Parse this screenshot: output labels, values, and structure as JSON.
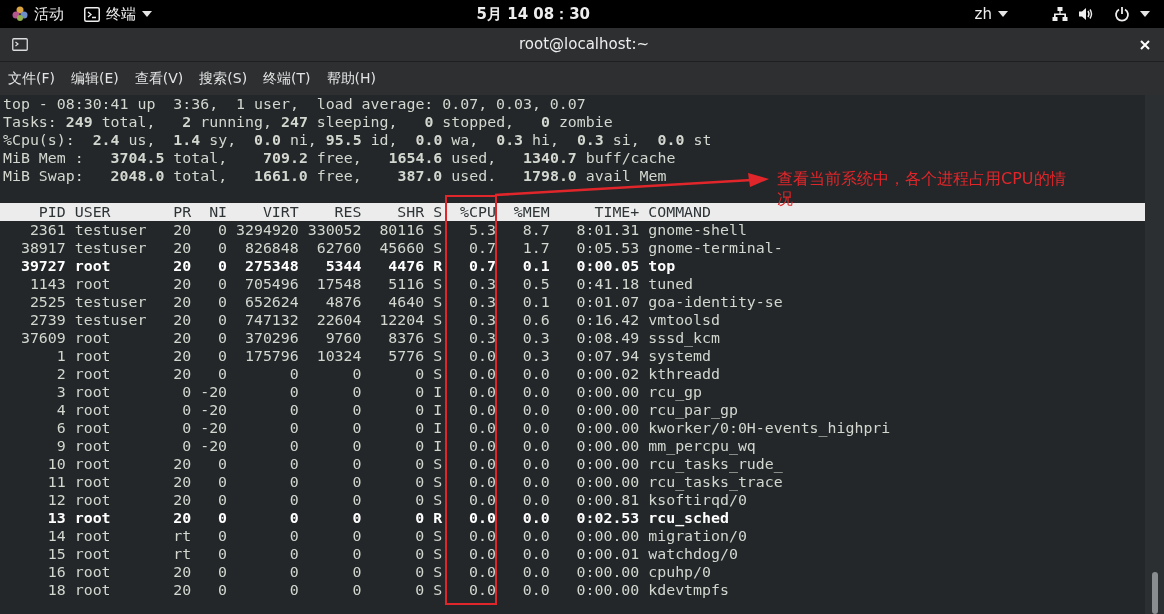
{
  "top_bar": {
    "activities": "活动",
    "app_menu": "终端",
    "clock": "5月 14 08：30",
    "input_method": "zh"
  },
  "window": {
    "title": "root@localhost:~"
  },
  "menu": [
    "文件(F)",
    "编辑(E)",
    "查看(V)",
    "搜索(S)",
    "终端(T)",
    "帮助(H)"
  ],
  "terminal": {
    "summary": [
      "top - 08:30:41 up  3:36,  1 user,  load average: 0.07, 0.03, 0.07",
      "Tasks: **249** total,   **2** running, **247** sleeping,   **0** stopped,   **0** zombie",
      "%Cpu(s):  **2.4** us,  **1.4** sy,  **0.0** ni, **95.5** id,  **0.0** wa,  **0.3** hi,  **0.3** si,  **0.0** st",
      "MiB Mem :   **3704.5** total,    **709.2** free,   **1654.6** used,   **1340.7** buff/cache",
      "MiB Swap:   **2048.0** total,   **1661.0** free,    **387.0** used.   **1798.0** avail Mem"
    ],
    "header": [
      "PID",
      "USER",
      "PR",
      "NI",
      "VIRT",
      "RES",
      "SHR",
      "S",
      "%CPU",
      "%MEM",
      "TIME+",
      "COMMAND"
    ],
    "processes": [
      {
        "bold": false,
        "cells": [
          "2361",
          "testuser",
          "20",
          "0",
          "3294920",
          "330052",
          "80116",
          "S",
          "5.3",
          "8.7",
          "8:01.31",
          "gnome-shell"
        ]
      },
      {
        "bold": false,
        "cells": [
          "38917",
          "testuser",
          "20",
          "0",
          "826848",
          "62760",
          "45660",
          "S",
          "0.7",
          "1.7",
          "0:05.53",
          "gnome-terminal-"
        ]
      },
      {
        "bold": true,
        "cells": [
          "39727",
          "root",
          "20",
          "0",
          "275348",
          "5344",
          "4476",
          "R",
          "0.7",
          "0.1",
          "0:00.05",
          "top"
        ]
      },
      {
        "bold": false,
        "cells": [
          "1143",
          "root",
          "20",
          "0",
          "705496",
          "17548",
          "5116",
          "S",
          "0.3",
          "0.5",
          "0:41.18",
          "tuned"
        ]
      },
      {
        "bold": false,
        "cells": [
          "2525",
          "testuser",
          "20",
          "0",
          "652624",
          "4876",
          "4640",
          "S",
          "0.3",
          "0.1",
          "0:01.07",
          "goa-identity-se"
        ]
      },
      {
        "bold": false,
        "cells": [
          "2739",
          "testuser",
          "20",
          "0",
          "747132",
          "22604",
          "12204",
          "S",
          "0.3",
          "0.6",
          "0:16.42",
          "vmtoolsd"
        ]
      },
      {
        "bold": false,
        "cells": [
          "37609",
          "root",
          "20",
          "0",
          "370296",
          "9760",
          "8376",
          "S",
          "0.3",
          "0.3",
          "0:08.49",
          "sssd_kcm"
        ]
      },
      {
        "bold": false,
        "cells": [
          "1",
          "root",
          "20",
          "0",
          "175796",
          "10324",
          "5776",
          "S",
          "0.0",
          "0.3",
          "0:07.94",
          "systemd"
        ]
      },
      {
        "bold": false,
        "cells": [
          "2",
          "root",
          "20",
          "0",
          "0",
          "0",
          "0",
          "S",
          "0.0",
          "0.0",
          "0:00.02",
          "kthreadd"
        ]
      },
      {
        "bold": false,
        "cells": [
          "3",
          "root",
          "0",
          "-20",
          "0",
          "0",
          "0",
          "I",
          "0.0",
          "0.0",
          "0:00.00",
          "rcu_gp"
        ]
      },
      {
        "bold": false,
        "cells": [
          "4",
          "root",
          "0",
          "-20",
          "0",
          "0",
          "0",
          "I",
          "0.0",
          "0.0",
          "0:00.00",
          "rcu_par_gp"
        ]
      },
      {
        "bold": false,
        "cells": [
          "6",
          "root",
          "0",
          "-20",
          "0",
          "0",
          "0",
          "I",
          "0.0",
          "0.0",
          "0:00.00",
          "kworker/0:0H-events_highpri"
        ]
      },
      {
        "bold": false,
        "cells": [
          "9",
          "root",
          "0",
          "-20",
          "0",
          "0",
          "0",
          "I",
          "0.0",
          "0.0",
          "0:00.00",
          "mm_percpu_wq"
        ]
      },
      {
        "bold": false,
        "cells": [
          "10",
          "root",
          "20",
          "0",
          "0",
          "0",
          "0",
          "S",
          "0.0",
          "0.0",
          "0:00.00",
          "rcu_tasks_rude_"
        ]
      },
      {
        "bold": false,
        "cells": [
          "11",
          "root",
          "20",
          "0",
          "0",
          "0",
          "0",
          "S",
          "0.0",
          "0.0",
          "0:00.00",
          "rcu_tasks_trace"
        ]
      },
      {
        "bold": false,
        "cells": [
          "12",
          "root",
          "20",
          "0",
          "0",
          "0",
          "0",
          "S",
          "0.0",
          "0.0",
          "0:00.81",
          "ksoftirqd/0"
        ]
      },
      {
        "bold": true,
        "cells": [
          "13",
          "root",
          "20",
          "0",
          "0",
          "0",
          "0",
          "R",
          "0.0",
          "0.0",
          "0:02.53",
          "rcu_sched"
        ]
      },
      {
        "bold": false,
        "cells": [
          "14",
          "root",
          "rt",
          "0",
          "0",
          "0",
          "0",
          "S",
          "0.0",
          "0.0",
          "0:00.00",
          "migration/0"
        ]
      },
      {
        "bold": false,
        "cells": [
          "15",
          "root",
          "rt",
          "0",
          "0",
          "0",
          "0",
          "S",
          "0.0",
          "0.0",
          "0:00.01",
          "watchdog/0"
        ]
      },
      {
        "bold": false,
        "cells": [
          "16",
          "root",
          "20",
          "0",
          "0",
          "0",
          "0",
          "S",
          "0.0",
          "0.0",
          "0:00.00",
          "cpuhp/0"
        ]
      },
      {
        "bold": false,
        "cells": [
          "18",
          "root",
          "20",
          "0",
          "0",
          "0",
          "0",
          "S",
          "0.0",
          "0.0",
          "0:00.00",
          "kdevtmpfs"
        ]
      }
    ]
  },
  "annotation": {
    "text": "查看当前系统中，各个进程占用CPU的情况"
  }
}
